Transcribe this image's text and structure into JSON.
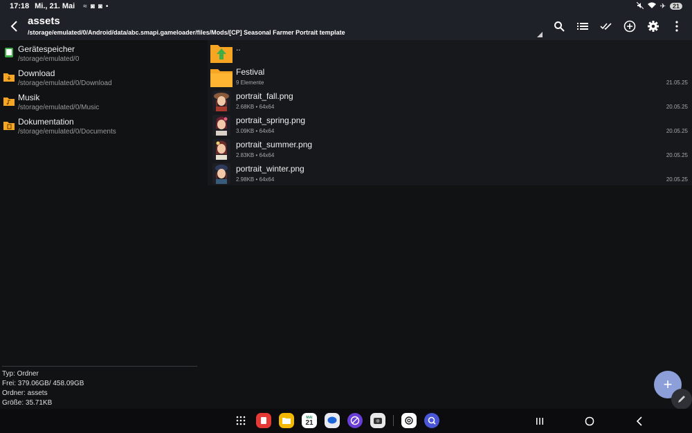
{
  "status": {
    "time": "17:18",
    "date": "Mi., 21. Mai",
    "battery": "21"
  },
  "header": {
    "title": "assets",
    "path": "/storage/emulated/0/Android/data/abc.smapi.gameloader/files/Mods/[CP] Seasonal Farmer Portrait template"
  },
  "toolbar": {
    "icons": [
      "search-icon",
      "list-view-icon",
      "select-all-icon",
      "add-circle-icon",
      "gear-icon",
      "more-vert-icon"
    ]
  },
  "drives": [
    {
      "name": "Gerätespeicher",
      "path": "/storage/emulated/0",
      "icon": "phone-storage-icon"
    },
    {
      "name": "Download",
      "path": "/storage/emulated/0/Download",
      "icon": "download-folder-icon"
    },
    {
      "name": "Musik",
      "path": "/storage/emulated/0/Music",
      "icon": "music-folder-icon"
    },
    {
      "name": "Dokumentation",
      "path": "/storage/emulated/0/Documents",
      "icon": "document-folder-icon"
    }
  ],
  "info": {
    "type": "Typ: Ordner",
    "free": "Frei: 379.06GB/ 458.09GB",
    "folder": "Ordner: assets",
    "size": "Größe: 35.71KB"
  },
  "files": [
    {
      "name": "..",
      "size": "",
      "dims": "",
      "date": "",
      "kind": "parent"
    },
    {
      "name": "Festival",
      "size": "9 Elemente",
      "dims": "",
      "date": "21.05.25",
      "kind": "folder"
    },
    {
      "name": "portrait_fall.png",
      "size": "2.68KB",
      "dims": "64x64",
      "date": "20.05.25",
      "kind": "image"
    },
    {
      "name": "portrait_spring.png",
      "size": "3.09KB",
      "dims": "64x64",
      "date": "20.05.25",
      "kind": "image"
    },
    {
      "name": "portrait_summer.png",
      "size": "2.83KB",
      "dims": "64x64",
      "date": "20.05.25",
      "kind": "image"
    },
    {
      "name": "portrait_winter.png",
      "size": "2.98KB",
      "dims": "64x64",
      "date": "20.05.25",
      "kind": "image"
    }
  ],
  "meta_sep": "•",
  "fab": {
    "label": "+"
  },
  "dock": {
    "calendar_day": "21",
    "calendar_month": "MAI",
    "apps": [
      "apps-grid-icon",
      "notes-app-icon",
      "files-app-icon",
      "calendar-app-icon",
      "messages-app-icon",
      "browser-app-icon",
      "camera-app-icon",
      "chatgpt-app-icon",
      "quick-search-app-icon"
    ]
  },
  "colors": {
    "accent": "#8c9fd9",
    "folder": "#f6a623",
    "background": "#111214",
    "appbar": "#1f2128"
  }
}
